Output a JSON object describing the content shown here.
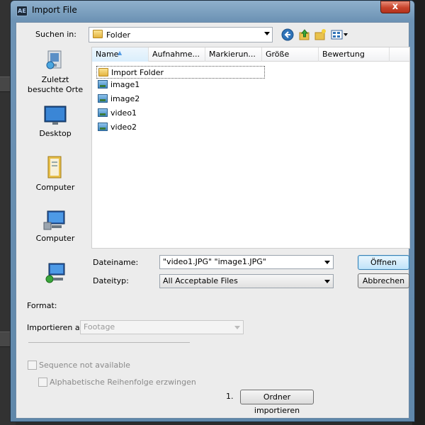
{
  "window": {
    "title": "Import File",
    "app_icon_label": "AE",
    "close_glyph": "x"
  },
  "look_in": {
    "label": "Suchen in:",
    "value": "Folder"
  },
  "toolbar_icons": [
    "back-icon",
    "up-folder-icon",
    "new-folder-icon",
    "view-menu-icon"
  ],
  "places": [
    {
      "label": "Zuletzt\nbesuchte Orte",
      "icon": "recent-places-icon"
    },
    {
      "label": "Desktop",
      "icon": "desktop-icon"
    },
    {
      "label": "Computer",
      "icon": "documents-icon"
    },
    {
      "label": "Computer",
      "icon": "computer-icon"
    },
    {
      "label": "",
      "icon": "network-icon"
    }
  ],
  "columns": [
    "Name",
    "Aufnahme...",
    "Markierun...",
    "Größe",
    "Bewertung"
  ],
  "files": [
    {
      "name": "Import Folder",
      "type": "folder"
    },
    {
      "name": "image1",
      "type": "image"
    },
    {
      "name": "image2",
      "type": "image"
    },
    {
      "name": "video1",
      "type": "image"
    },
    {
      "name": "video2",
      "type": "image"
    }
  ],
  "filename": {
    "label": "Dateiname:",
    "value": "\"video1.JPG\" \"image1.JPG\""
  },
  "filetype": {
    "label": "Dateityp:",
    "value": "All Acceptable Files"
  },
  "buttons": {
    "open": "Öffnen",
    "cancel": "Abbrechen",
    "import_folder": "Ordner importieren"
  },
  "format": {
    "label": "Format:"
  },
  "import_as": {
    "label": "Importieren als:",
    "value": "Footage"
  },
  "sequence": {
    "label": "Sequence not available"
  },
  "alphabetical": {
    "label": "Alphabetische Reihenfolge erzwingen"
  },
  "step_number": "1.",
  "colors": {
    "frame": "#6d93b5",
    "client_bg": "#ececec",
    "close": "#c8432b",
    "default_button": "#bfe3f9"
  }
}
